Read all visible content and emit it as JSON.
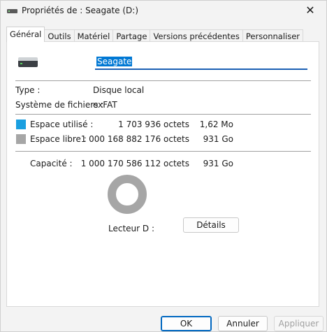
{
  "window": {
    "title": "Propriétés de : Seagate (D:)",
    "close_glyph": "✕"
  },
  "tabs": [
    {
      "label": "Général",
      "active": true
    },
    {
      "label": "Outils"
    },
    {
      "label": "Matériel"
    },
    {
      "label": "Partage"
    },
    {
      "label": "Versions précédentes"
    },
    {
      "label": "Personnaliser"
    }
  ],
  "general": {
    "volume_name": "Seagate",
    "type_label": "Type :",
    "type_value": "Disque local",
    "fs_label": "Système de fichiers :",
    "fs_value": "exFAT",
    "used": {
      "label": "Espace utilisé :",
      "bytes": "1 703 936 octets",
      "size": "1,62 Mo",
      "color": "#1a9fe0"
    },
    "free": {
      "label": "Espace libre :",
      "bytes": "1 000 168 882 176 octets",
      "size": "931 Go",
      "color": "#a6a6a6"
    },
    "capacity": {
      "label": "Capacité :",
      "bytes": "1 000 170 586 112 octets",
      "size": "931 Go"
    },
    "drive_label": "Lecteur D :",
    "details_button": "Détails",
    "used_fraction": 1.7e-06
  },
  "footer": {
    "ok": "OK",
    "cancel": "Annuler",
    "apply": "Appliquer"
  }
}
